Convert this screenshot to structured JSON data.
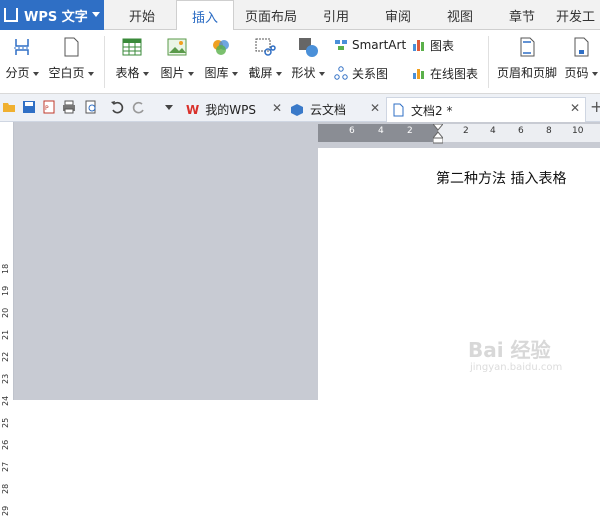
{
  "app": {
    "title": "WPS 文字"
  },
  "menu": {
    "tabs": [
      "开始",
      "插入",
      "页面布局",
      "引用",
      "审阅",
      "视图",
      "章节",
      "开发工"
    ],
    "active_index": 1
  },
  "ribbon": {
    "page_break": "分页",
    "blank_page": "空白页",
    "table": "表格",
    "picture": "图片",
    "gallery": "图库",
    "screenshot": "截屏",
    "shapes": "形状",
    "smartart": "SmartArt",
    "chart": "图表",
    "relation_chart": "关系图",
    "online_chart": "在线图表",
    "header_footer": "页眉和页脚",
    "page_number": "页码"
  },
  "doc_tabs": [
    {
      "label": "我的WPS"
    },
    {
      "label": "云文档"
    },
    {
      "label": "文档2 *"
    }
  ],
  "ruler": {
    "h_ticks": [
      "6",
      "4",
      "2",
      "2",
      "4",
      "6",
      "8",
      "10"
    ],
    "v_ticks": [
      "18",
      "19",
      "20",
      "21",
      "22",
      "23",
      "24",
      "25",
      "26",
      "27",
      "28",
      "29"
    ]
  },
  "document": {
    "text": "第二种方法 插入表格"
  },
  "watermark": {
    "brand": "Bai 经验",
    "url": "jingyan.baidu.com"
  },
  "colors": {
    "accent": "#2f6fc5",
    "tab_active_text": "#2b6cc4",
    "workspace_bg": "#c8cbd3"
  }
}
